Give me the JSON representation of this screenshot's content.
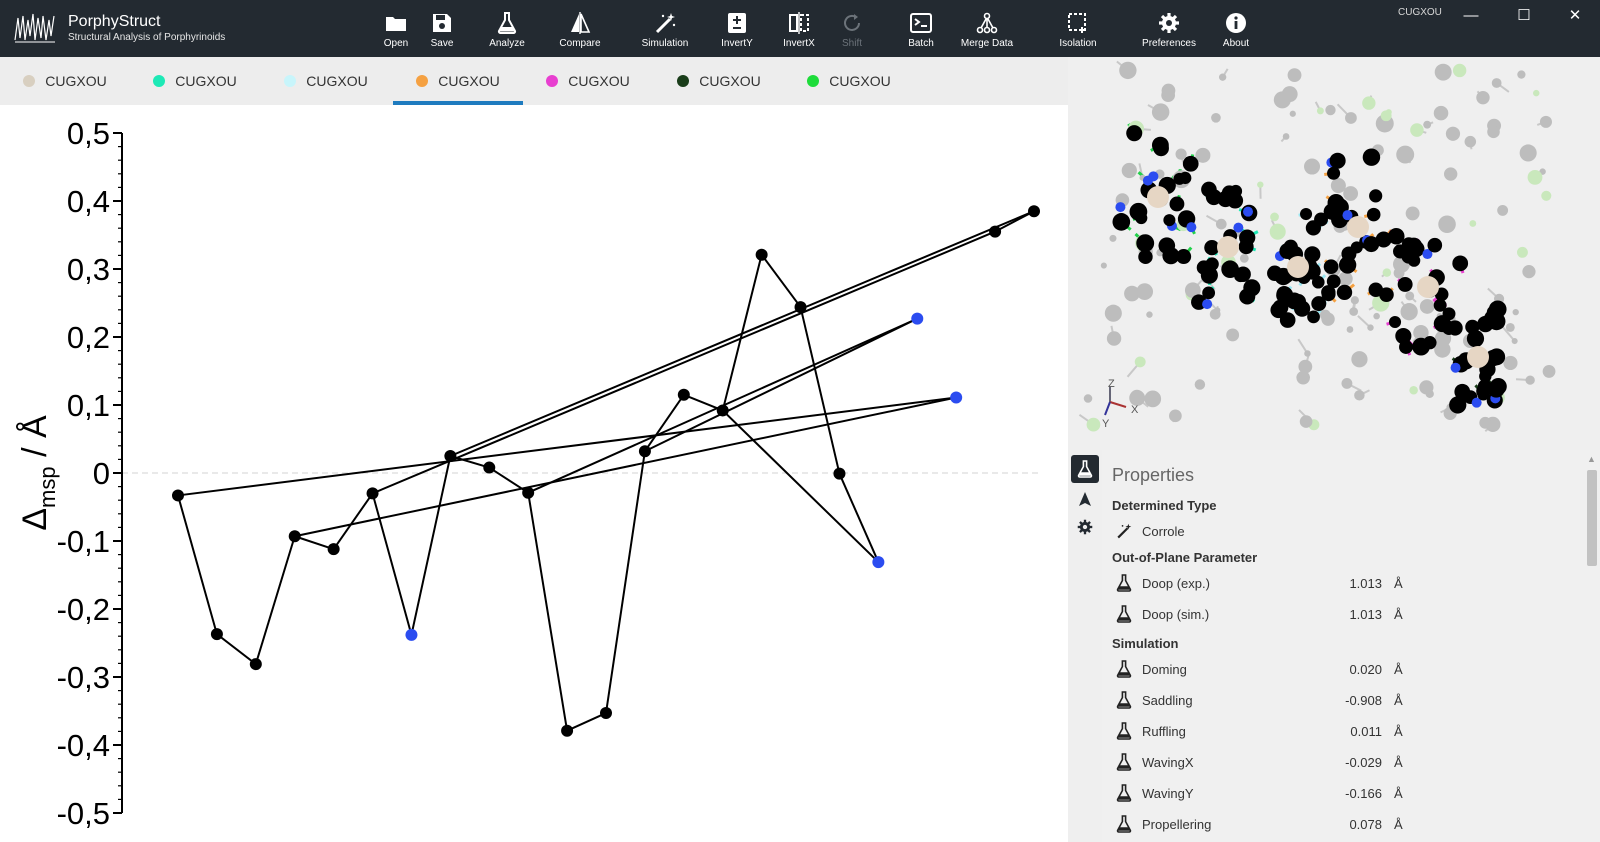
{
  "app": {
    "name": "PorphyStruct",
    "subtitle": "Structural Analysis of Porphyrinoids",
    "window_title": "CUGXOU"
  },
  "toolbar": [
    {
      "label": "Open",
      "icon": "folder-icon",
      "enabled": true
    },
    {
      "label": "Save",
      "icon": "save-icon",
      "enabled": true
    },
    {
      "label": "Analyze",
      "icon": "flask-icon",
      "enabled": true
    },
    {
      "label": "Compare",
      "icon": "compare-icon",
      "enabled": true
    },
    {
      "label": "Simulation",
      "icon": "magic-wand-icon",
      "enabled": true
    },
    {
      "label": "InvertY",
      "icon": "plus-minus-icon",
      "enabled": true
    },
    {
      "label": "InvertX",
      "icon": "mirror-icon",
      "enabled": true
    },
    {
      "label": "Shift",
      "icon": "rotate-icon",
      "enabled": false
    },
    {
      "label": "Batch",
      "icon": "terminal-icon",
      "enabled": true
    },
    {
      "label": "Merge Data",
      "icon": "merge-icon",
      "enabled": true
    },
    {
      "label": "Isolation",
      "icon": "selection-icon",
      "enabled": true
    },
    {
      "label": "Preferences",
      "icon": "gear-icon",
      "enabled": true
    },
    {
      "label": "About",
      "icon": "info-icon",
      "enabled": true
    }
  ],
  "window_controls": {
    "minimize": "—",
    "maximize": "☐",
    "close": "✕"
  },
  "tabs": [
    {
      "label": "CUGXOU",
      "color": "#d8cfc0",
      "active": false
    },
    {
      "label": "CUGXOU",
      "color": "#1de9b6",
      "active": false
    },
    {
      "label": "CUGXOU",
      "color": "#c8f5fb",
      "active": false
    },
    {
      "label": "CUGXOU",
      "color": "#f5a142",
      "active": true
    },
    {
      "label": "CUGXOU",
      "color": "#e83fd0",
      "active": false
    },
    {
      "label": "CUGXOU",
      "color": "#1a3d1a",
      "active": false
    },
    {
      "label": "CUGXOU",
      "color": "#1edc3a",
      "active": false
    }
  ],
  "chart_data": {
    "type": "line",
    "ylabel_main": "Δ",
    "ylabel_sub": "msp",
    "ylabel_unit": " / Å",
    "ylim": [
      -0.5,
      0.5
    ],
    "y_ticks": [
      0.5,
      0.4,
      0.3,
      0.2,
      0.1,
      0,
      -0.1,
      -0.2,
      -0.3,
      -0.4,
      -0.5
    ],
    "y_tick_labels": [
      "0,5",
      "0,4",
      "0,3",
      "0,2",
      "0,1",
      "0",
      "-0,1",
      "-0,2",
      "-0,3",
      "-0,4",
      "-0,5"
    ],
    "line_color": "#000000",
    "highlight_color": "#2b4cf0",
    "points": [
      {
        "x": 1,
        "y": -0.033,
        "h": false
      },
      {
        "x": 2,
        "y": -0.237,
        "h": false
      },
      {
        "x": 3,
        "y": -0.281,
        "h": false
      },
      {
        "x": 4,
        "y": -0.093,
        "h": false
      },
      {
        "x": 5,
        "y": -0.112,
        "h": false
      },
      {
        "x": 6,
        "y": -0.03,
        "h": false
      },
      {
        "x": 7,
        "y": -0.238,
        "h": true
      },
      {
        "x": 8,
        "y": 0.025,
        "h": false
      },
      {
        "x": 9,
        "y": 0.008,
        "h": false
      },
      {
        "x": 10,
        "y": -0.029,
        "h": false
      },
      {
        "x": 11,
        "y": -0.379,
        "h": false
      },
      {
        "x": 12,
        "y": -0.353,
        "h": false
      },
      {
        "x": 13,
        "y": 0.032,
        "h": false
      },
      {
        "x": 14,
        "y": 0.115,
        "h": false
      },
      {
        "x": 15,
        "y": 0.092,
        "h": false
      },
      {
        "x": 16,
        "y": 0.321,
        "h": false
      },
      {
        "x": 17,
        "y": 0.244,
        "h": false
      },
      {
        "x": 18,
        "y": -0.001,
        "h": false
      },
      {
        "x": 19,
        "y": -0.131,
        "h": true
      },
      {
        "x": 20,
        "y": 0.227,
        "h": true
      },
      {
        "x": 21,
        "y": 0.111,
        "h": true
      },
      {
        "x": 22,
        "y": 0.355,
        "h": false
      },
      {
        "x": 23,
        "y": 0.385,
        "h": false
      }
    ],
    "segments": [
      [
        1,
        2
      ],
      [
        2,
        3
      ],
      [
        3,
        4
      ],
      [
        4,
        5
      ],
      [
        5,
        6
      ],
      [
        6,
        7
      ],
      [
        7,
        8
      ],
      [
        8,
        9
      ],
      [
        9,
        10
      ],
      [
        10,
        11
      ],
      [
        11,
        12
      ],
      [
        12,
        13
      ],
      [
        13,
        14
      ],
      [
        14,
        15
      ],
      [
        15,
        16
      ],
      [
        16,
        17
      ],
      [
        17,
        18
      ],
      [
        18,
        19
      ],
      [
        19,
        15
      ],
      [
        13,
        20
      ],
      [
        20,
        10
      ],
      [
        1,
        21
      ],
      [
        21,
        4
      ],
      [
        6,
        22
      ],
      [
        22,
        23
      ],
      [
        23,
        8
      ]
    ]
  },
  "view3d": {
    "axis_z": "Z",
    "axis_x": "X",
    "axis_y": "Y"
  },
  "side_strip": [
    {
      "icon": "flask-icon",
      "active": true
    },
    {
      "icon": "navigation-arrow-icon",
      "active": false
    },
    {
      "icon": "gear-icon",
      "active": false
    }
  ],
  "properties": {
    "title": "Properties",
    "determined_type_header": "Determined Type",
    "determined_type": "Corrole",
    "oop_header": "Out-of-Plane Parameter",
    "oop": [
      {
        "name": "Doop (exp.)",
        "value": "1.013",
        "unit": "Å"
      },
      {
        "name": "Doop (sim.)",
        "value": "1.013",
        "unit": "Å"
      }
    ],
    "simulation_header": "Simulation",
    "simulation": [
      {
        "name": "Doming",
        "value": "0.020",
        "unit": "Å"
      },
      {
        "name": "Saddling",
        "value": "-0.908",
        "unit": "Å"
      },
      {
        "name": "Ruffling",
        "value": "0.011",
        "unit": "Å"
      },
      {
        "name": "WavingX",
        "value": "-0.029",
        "unit": "Å"
      },
      {
        "name": "WavingY",
        "value": "-0.166",
        "unit": "Å"
      },
      {
        "name": "Propellering",
        "value": "0.078",
        "unit": "Å"
      }
    ]
  }
}
